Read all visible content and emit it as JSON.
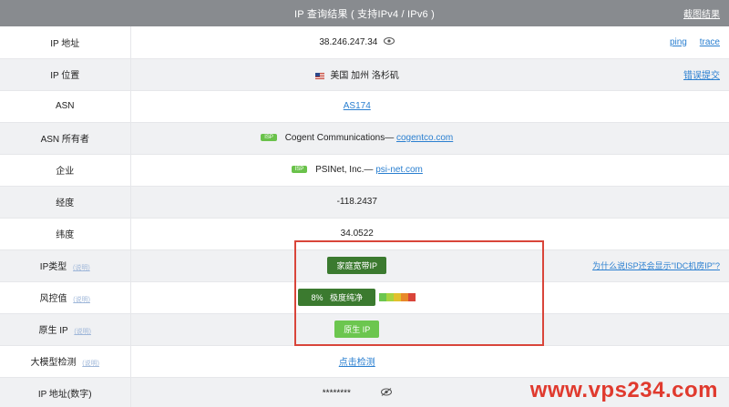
{
  "header": {
    "title": "IP 查询结果 ( 支持IPv4 / IPv6 )",
    "screenshot_link": "截图结果"
  },
  "rows": {
    "ip": {
      "label": "IP 地址",
      "value": "38.246.247.34",
      "ping": "ping",
      "trace": "trace"
    },
    "location": {
      "label": "IP 位置",
      "value": "美国 加州 洛杉矶",
      "report": "错误提交"
    },
    "asn": {
      "label": "ASN",
      "value": "AS174"
    },
    "asn_owner": {
      "label": "ASN 所有者",
      "badge": "ISP",
      "name": "Cogent Communications—",
      "domain": "cogentco.com"
    },
    "company": {
      "label": "企业",
      "badge": "ISP",
      "name": "PSINet, Inc.—",
      "domain": "psi-net.com"
    },
    "longitude": {
      "label": "经度",
      "value": "-118.2437"
    },
    "latitude": {
      "label": "纬度",
      "value": "34.0522"
    },
    "ip_type": {
      "label": "IP类型",
      "help": "(说明)",
      "value": "家庭宽带IP",
      "question": "为什么说ISP还会显示\"IDC机房IP\"?"
    },
    "risk": {
      "label": "风控值",
      "help": "(说明)",
      "percent": "8%",
      "text": "极度纯净",
      "level_colors": [
        "#6cc64f",
        "#a8d33f",
        "#e2c02c",
        "#e8892a",
        "#d9453a"
      ]
    },
    "native": {
      "label": "原生 IP",
      "help": "(说明)",
      "value": "原生 IP"
    },
    "ai_detect": {
      "label": "大模型检测",
      "help": "(说明)",
      "action": "点击检测"
    },
    "ip_number": {
      "label": "IP 地址(数字)",
      "value": "********"
    }
  },
  "watermark": "www.vps234.com"
}
